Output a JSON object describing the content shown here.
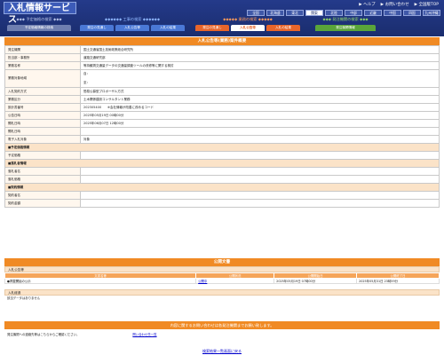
{
  "header": {
    "logo": "入札情報サービス",
    "top_links": [
      "ヘルプ",
      "お問い合わせ",
      "全国版TOP"
    ],
    "regions": [
      {
        "label": "全国",
        "selected": false
      },
      {
        "label": "北海道",
        "selected": false
      },
      {
        "label": "東北",
        "selected": false
      },
      {
        "label": "関東",
        "selected": true
      },
      {
        "label": "北陸",
        "selected": false
      },
      {
        "label": "中部",
        "selected": false
      },
      {
        "label": "近畿",
        "selected": false
      },
      {
        "label": "中国",
        "selected": false
      },
      {
        "label": "四国",
        "selected": false
      },
      {
        "label": "九州沖縄",
        "selected": false
      }
    ]
  },
  "categories": [
    {
      "title": "◆◆◆ 予定価格の検索 ◆◆◆",
      "tabs": [
        "予定価格情報の検索"
      ]
    },
    {
      "title": "◆◆◆◆◆◆ 工事の検索 ◆◆◆◆◆◆",
      "tabs": [
        "発注の見通し",
        "入札公告等",
        "入札の結果"
      ]
    },
    {
      "title": "◆◆◆◆◆ 業務の検索 ◆◆◆◆◆",
      "tabs": [
        "発注の見通し",
        "入札公告等",
        "入札の結果"
      ],
      "active": 1
    },
    {
      "title": "◆◆◆ 発注機関の検索 ◆◆◆",
      "tabs": [
        "発注機関情報"
      ]
    }
  ],
  "detail": {
    "title": "入札公告等(業務)案件概要",
    "rows": [
      {
        "label": "発注機関",
        "value": "国土交通省国土技術政策総合研究所",
        "section": false
      },
      {
        "label": "担当部・事務所",
        "value": "道路交通研究部",
        "section": false
      },
      {
        "label": "業務名称",
        "value": "等持観測交通量データの交通量調査ツールの改修等に関する検討",
        "section": false
      },
      {
        "label": "業務対象地域",
        "value": "自：",
        "section": false,
        "extra": "至："
      },
      {
        "label": "入札契約方式",
        "value": "簡易公募型プロポーザル方式",
        "section": false
      },
      {
        "label": "業務区分",
        "value": "土木関係建設コンサルタント業務",
        "section": false
      },
      {
        "label": "設計書番号",
        "value": "202305400　　※会社情報が改善に改めるコード",
        "section": false
      },
      {
        "label": "公告日時",
        "value": "2025年05月19日 00時00分",
        "section": false
      },
      {
        "label": "開札日時",
        "value": "2025年06月07日 12時00分",
        "section": false
      },
      {
        "label": "開札日時",
        "value": "",
        "section": false
      },
      {
        "label": "電子入札対象",
        "value": "対象",
        "section": false
      },
      {
        "label": "■予定価格情報",
        "value": "",
        "section": true
      },
      {
        "label": "予定価格",
        "value": "",
        "section": false
      },
      {
        "label": "■落札者情報",
        "value": "",
        "section": true
      },
      {
        "label": "落札者名",
        "value": "",
        "section": false
      },
      {
        "label": "落札価格",
        "value": "",
        "section": false
      },
      {
        "label": "■契約情報",
        "value": "",
        "section": true
      },
      {
        "label": "契約者名",
        "value": "",
        "section": false
      },
      {
        "label": "契約金額",
        "value": "",
        "section": false
      }
    ]
  },
  "documents": {
    "title": "公開文書",
    "notice_bar": "入札公告等",
    "columns": [
      "文書名等",
      "公開状況",
      "公開開始日",
      "公開終了日"
    ],
    "rows": [
      {
        "name": "●掲載開始の公示",
        "status": "公開中",
        "start": "2025年05月19日 07時00分",
        "end": "2025年05月31日 23時59分"
      }
    ],
    "result_bar": "入札経過",
    "no_data": "該当データはありません"
  },
  "contact": {
    "header": "内容に関するお問い合わせは各発注機関までお願い致します。",
    "text": "発注機関への連絡先等はこちらからご確認ください。",
    "link": "問い合わせ先一覧"
  },
  "back_link": "検索結果一覧画面に戻る",
  "colors": {
    "header": "#1a2d6e",
    "accent": "#f08a24",
    "section": "#fbe3c8"
  }
}
